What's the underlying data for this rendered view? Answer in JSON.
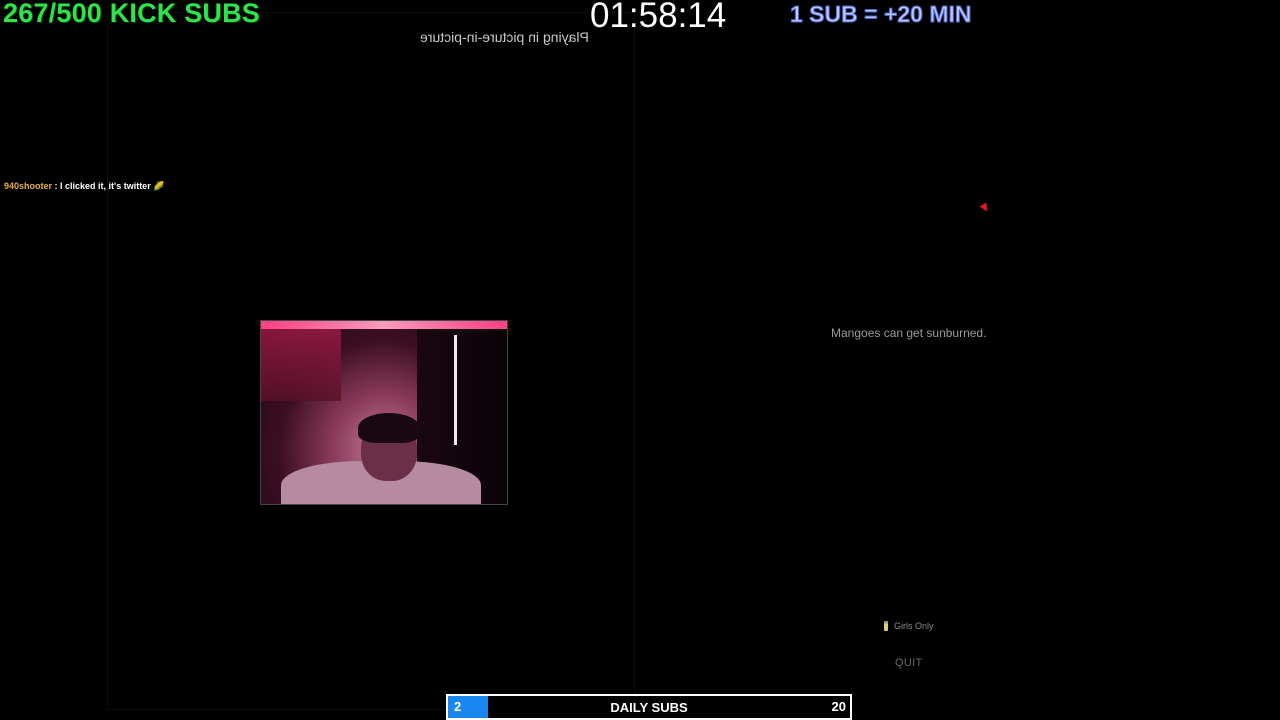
{
  "overlay": {
    "sub_goal": "267/500 KICK SUBS",
    "sub_goal_color": "#2fe34a",
    "timer": "01:58:14",
    "rate": "1 SUB = +20 MIN",
    "rate_color": "#b9c8ff",
    "pip_label": "Playing in picture-in-picture"
  },
  "chat": {
    "username": "940shooter",
    "separator": " : ",
    "message": "I clicked it, it's twitter 🌽"
  },
  "webcam": {
    "icon": "webcam-feed"
  },
  "right_panel": {
    "fact": "Mangoes can get sunburned.",
    "girls_only_label": "Girls Only",
    "quit_label": "QUIT"
  },
  "daily_subs": {
    "current": "2",
    "title": "DAILY SUBS",
    "goal": "20",
    "progress": 0.1,
    "fill_color": "#1a86f0"
  }
}
